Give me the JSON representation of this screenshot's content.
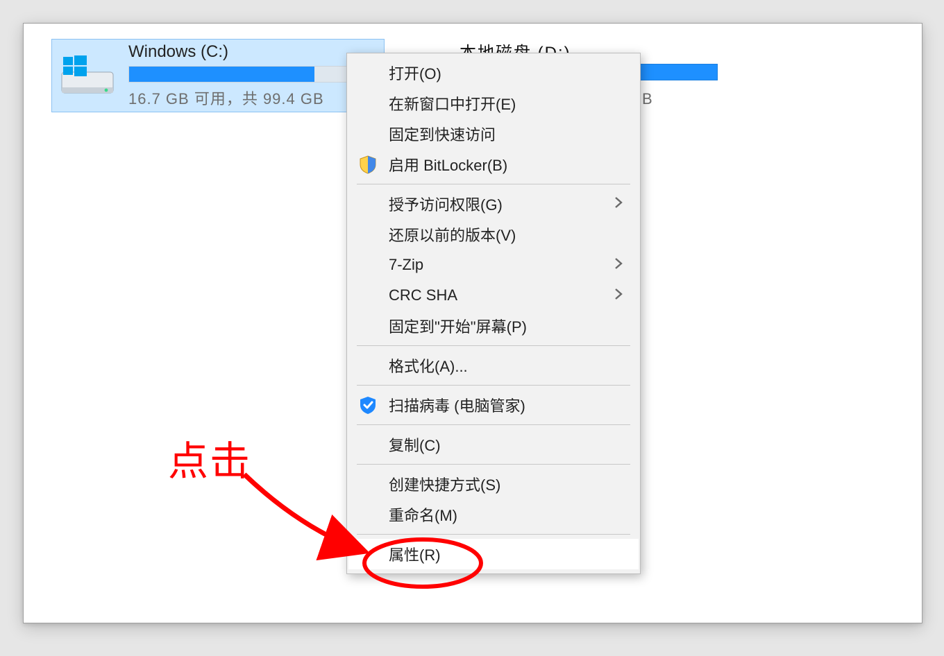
{
  "drive1": {
    "name": "Windows (C:)",
    "sub": "16.7 GB 可用，共 99.4 GB",
    "used_percent": 83.3
  },
  "drive2": {
    "label_peek": "本地磁盘 (D:)",
    "tail_peek": "B"
  },
  "menu": {
    "open": "打开(O)",
    "open_new_window": "在新窗口中打开(E)",
    "pin_quick_access": "固定到快速访问",
    "bitlocker": "启用 BitLocker(B)",
    "grant_access": "授予访问权限(G)",
    "restore_prev": "还原以前的版本(V)",
    "sevenzip": "7-Zip",
    "crc_sha": "CRC SHA",
    "pin_start": "固定到\"开始\"屏幕(P)",
    "format": "格式化(A)...",
    "scan_virus": "扫描病毒 (电脑管家)",
    "copy": "复制(C)",
    "create_shortcut": "创建快捷方式(S)",
    "rename": "重命名(M)",
    "properties": "属性(R)"
  },
  "annotation": {
    "text": "点击"
  },
  "colors": {
    "selection_bg": "#cce8ff",
    "accent": "#1e90ff",
    "anno": "#ff0000"
  }
}
